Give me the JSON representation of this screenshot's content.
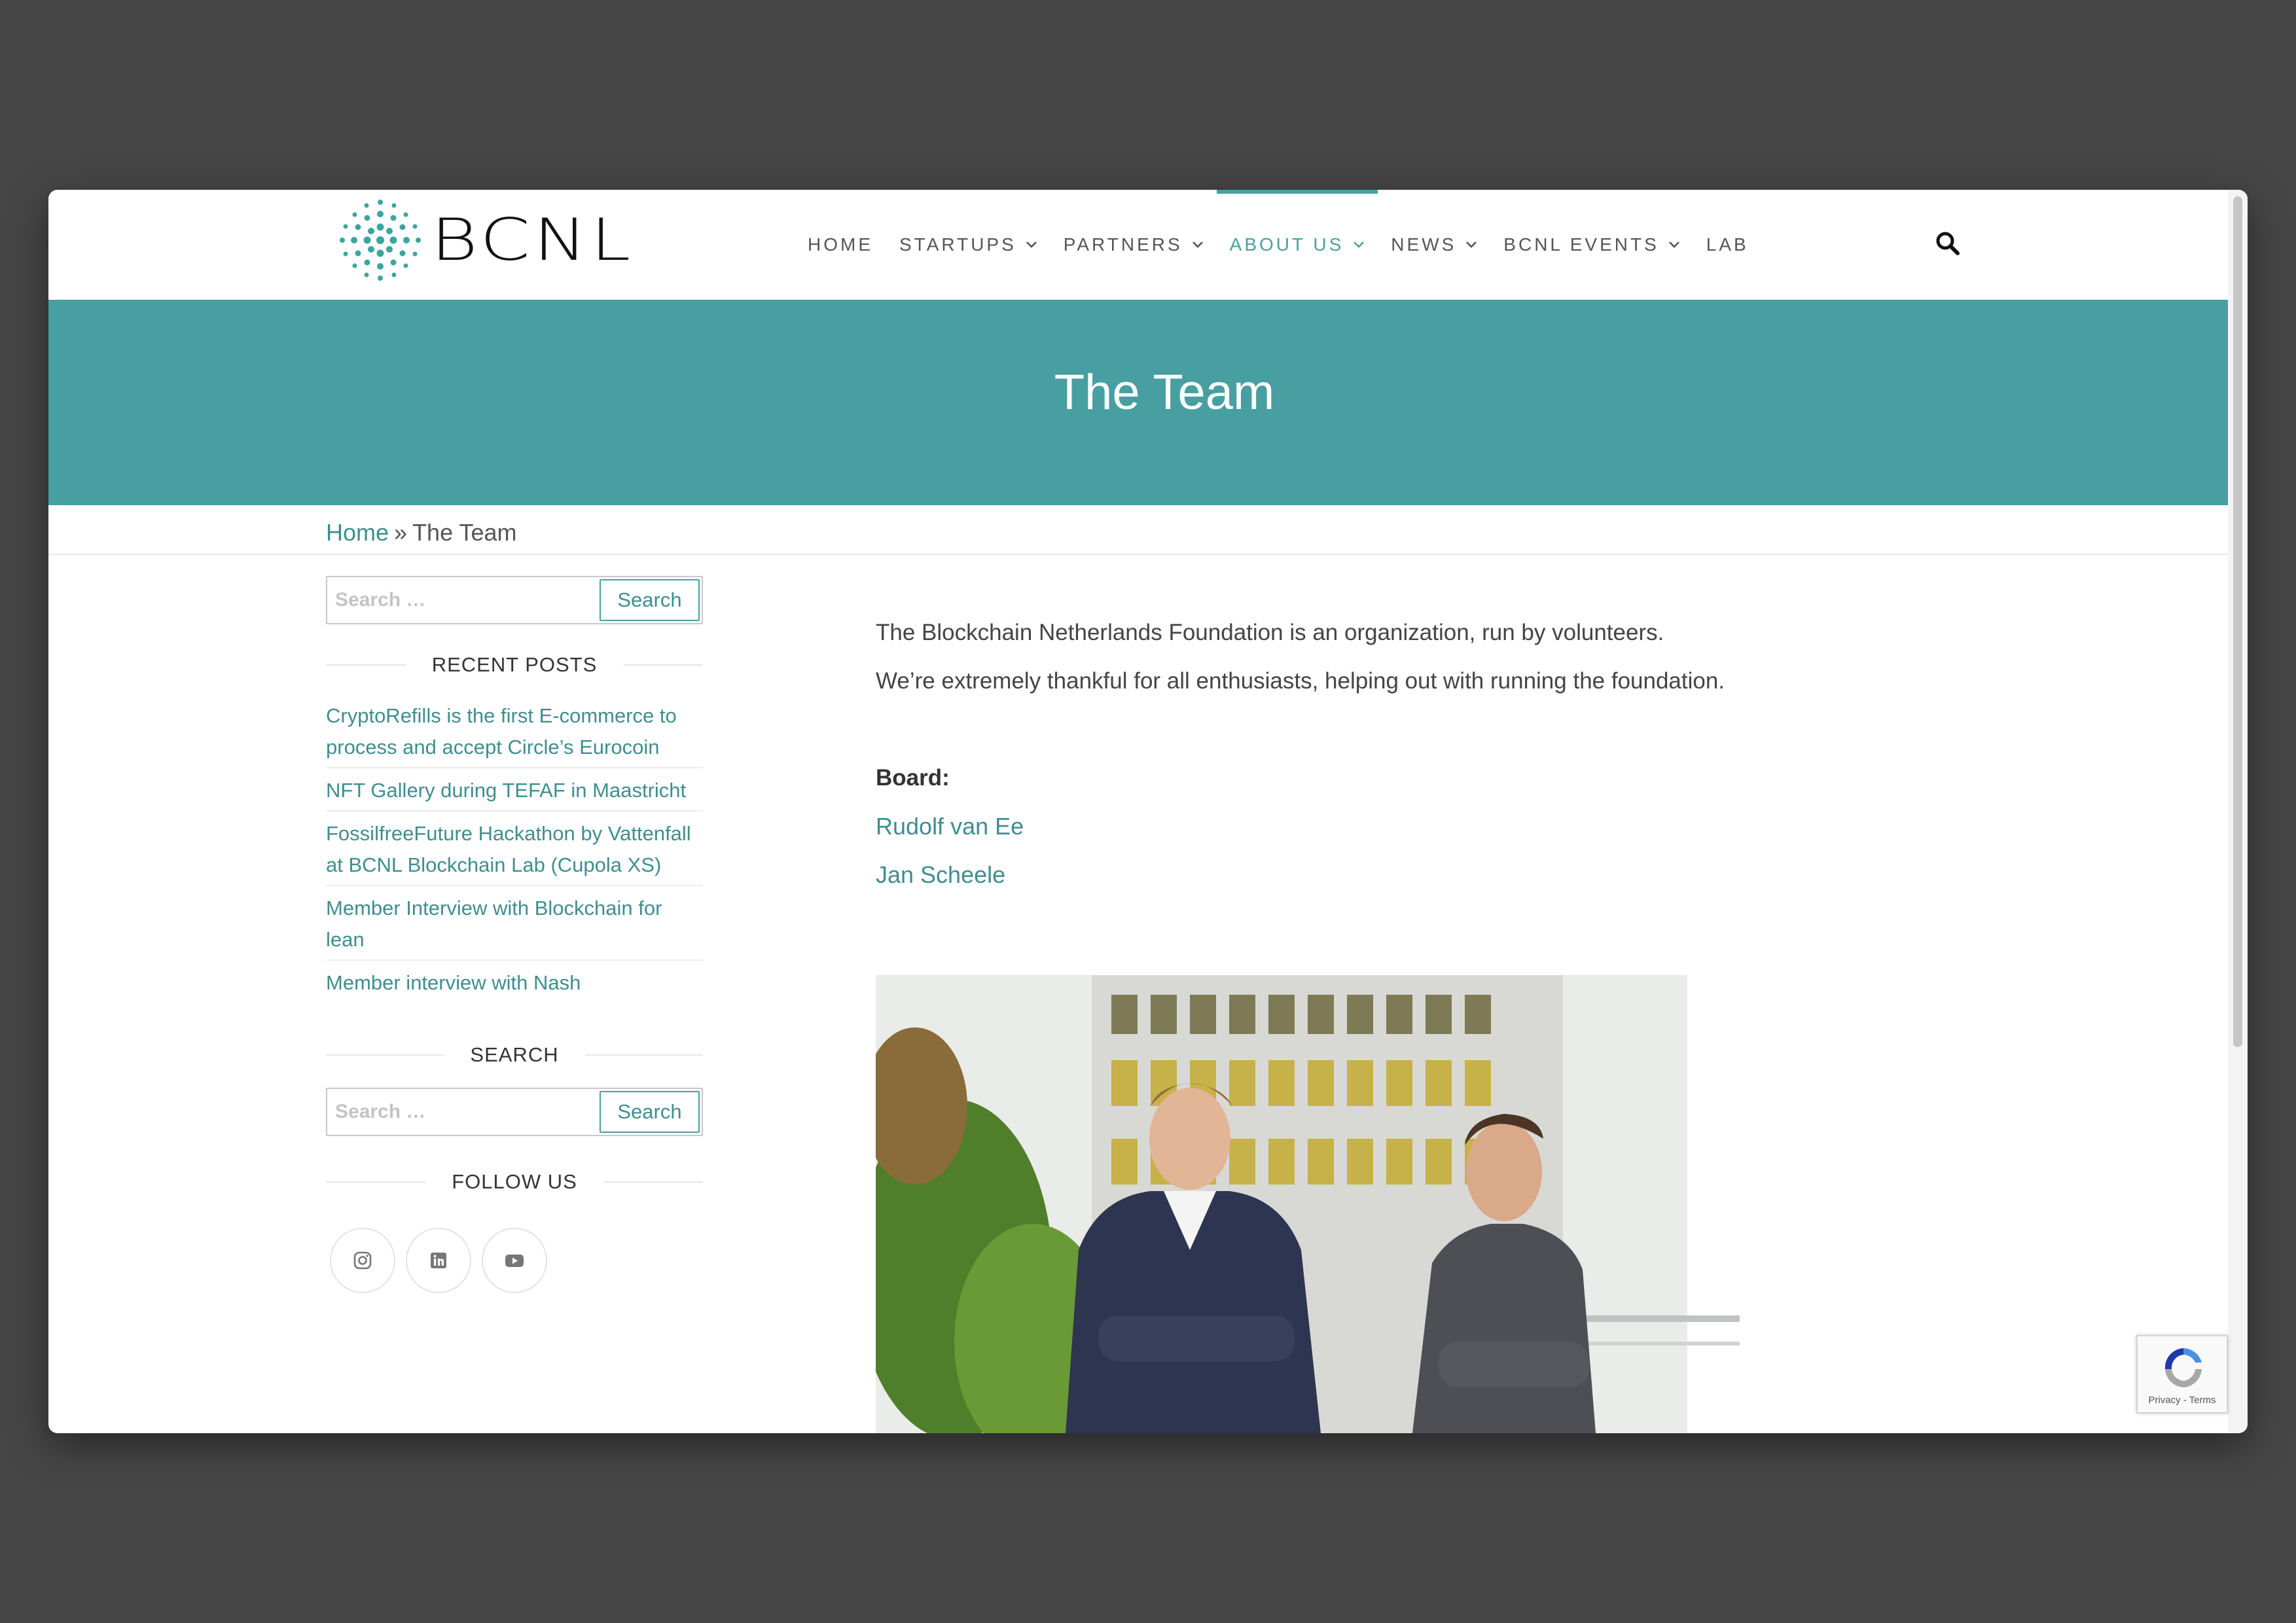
{
  "header": {
    "logo_text": "BCNL",
    "nav": [
      {
        "label": "HOME",
        "dropdown": false
      },
      {
        "label": "STARTUPS",
        "dropdown": true
      },
      {
        "label": "PARTNERS",
        "dropdown": true
      },
      {
        "label": "ABOUT US",
        "dropdown": true,
        "active": true
      },
      {
        "label": "NEWS",
        "dropdown": true
      },
      {
        "label": "BCNL EVENTS",
        "dropdown": true
      },
      {
        "label": "LAB",
        "dropdown": false
      }
    ]
  },
  "hero": {
    "title": "The Team"
  },
  "breadcrumb": {
    "home": "Home",
    "separator": "»",
    "current": "The Team"
  },
  "sidebar": {
    "search_top": {
      "placeholder": "Search …",
      "button": "Search"
    },
    "recent_posts_title": "RECENT POSTS",
    "recent_posts": [
      "CryptoRefills is the first E-commerce to process and accept Circle’s Eurocoin",
      "NFT Gallery during TEFAF in Maastricht",
      "FossilfreeFuture Hackathon by Vattenfall at BCNL Blockchain Lab (Cupola XS)",
      "Member Interview with Blockchain for lean",
      "Member interview with Nash"
    ],
    "search_title": "SEARCH",
    "search_bottom": {
      "placeholder": "Search …",
      "button": "Search"
    },
    "follow_title": "FOLLOW US",
    "social": [
      "instagram-icon",
      "linkedin-icon",
      "youtube-icon"
    ]
  },
  "content": {
    "para1": "The Blockchain Netherlands Foundation is an organization, run by volunteers.",
    "para2": "We’re extremely thankful for all enthusiasts, helping out with running the foundation.",
    "board_label": "Board:",
    "members": [
      "Rudolf van Ee",
      "Jan Scheele"
    ]
  },
  "recaptcha": {
    "text": "Privacy - Terms"
  },
  "colors": {
    "accent": "#489fa1",
    "link": "#3f8e8f",
    "backdrop": "#464647"
  }
}
